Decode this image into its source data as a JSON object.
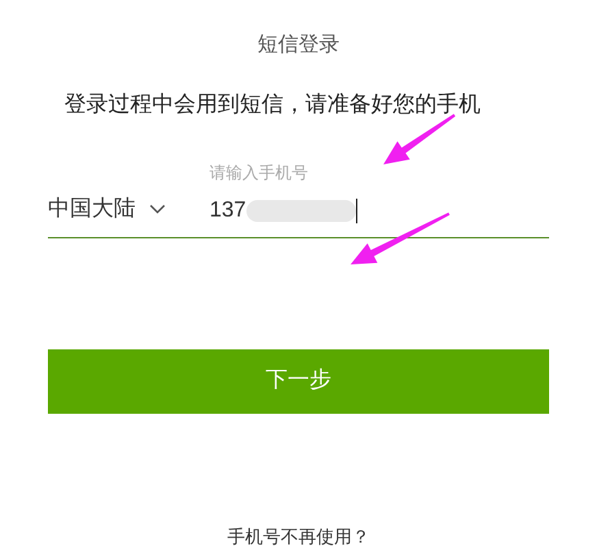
{
  "title": "短信登录",
  "notice": "登录过程中会用到短信，请准备好您的手机",
  "region_select": {
    "value": "中国大陆"
  },
  "phone_field": {
    "placeholder": "请输入手机号",
    "value": "137",
    "redacted": true
  },
  "next_button": "下一步",
  "footer_link": "手机号不再使用？",
  "annotations": [
    {
      "kind": "arrow"
    },
    {
      "kind": "arrow"
    }
  ]
}
